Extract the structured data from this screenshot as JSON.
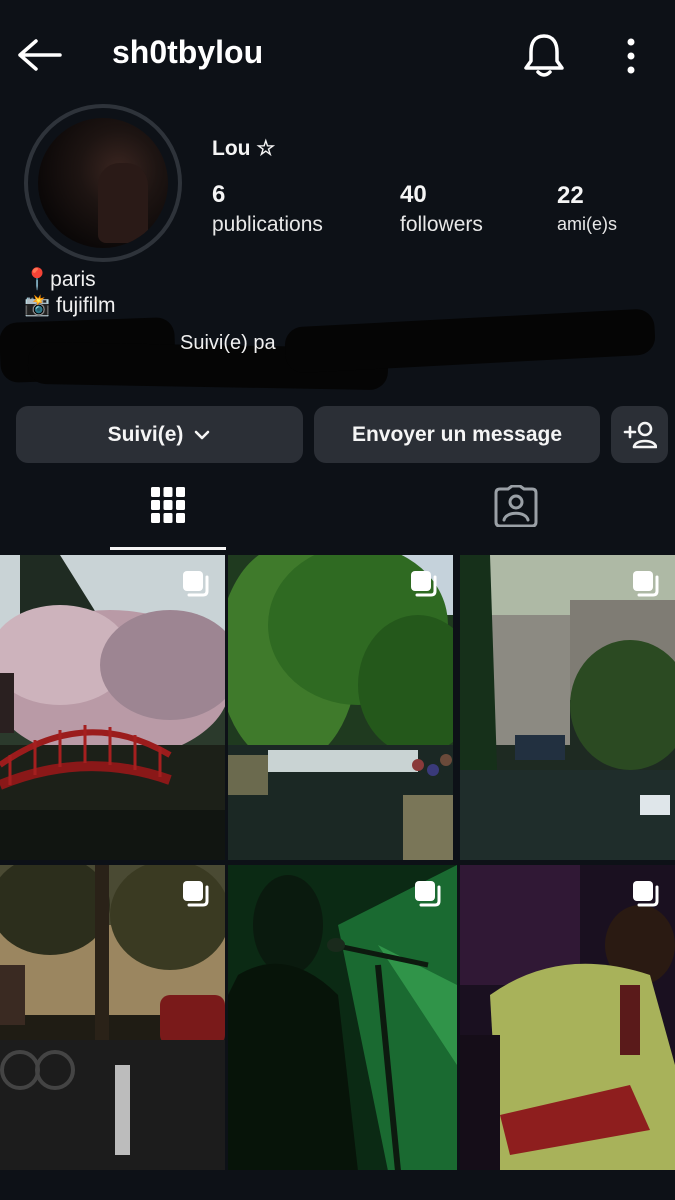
{
  "header": {
    "username": "sh0tbylou"
  },
  "profile": {
    "display_name": "Lou ☆",
    "stats": [
      {
        "value": "6",
        "label": "publications"
      },
      {
        "value": "40",
        "label": "followers"
      },
      {
        "value": "22",
        "label": "ami(e)s"
      }
    ],
    "bio": [
      "📍paris",
      "📸 fujifilm"
    ],
    "followed_by": "Suivi(e) pa"
  },
  "actions": {
    "following_label": "Suivi(e)",
    "message_label": "Envoyer un message"
  },
  "tabs": [
    {
      "icon": "grid-icon",
      "active": true
    },
    {
      "icon": "tagged-icon",
      "active": false
    }
  ],
  "posts": [
    {
      "scene": "cherry blossoms and red bridge",
      "icon": "multiple-photos-icon"
    },
    {
      "scene": "weeping willow and weir",
      "icon": "multiple-photos-icon"
    },
    {
      "scene": "canal with boats and buildings",
      "icon": "multiple-photos-icon"
    },
    {
      "scene": "street at sunset with cyclist",
      "icon": "multiple-photos-icon"
    },
    {
      "scene": "singer silhouette green light",
      "icon": "multiple-photos-icon"
    },
    {
      "scene": "musician with guitar and harmonica",
      "icon": "multiple-photos-icon"
    }
  ]
}
